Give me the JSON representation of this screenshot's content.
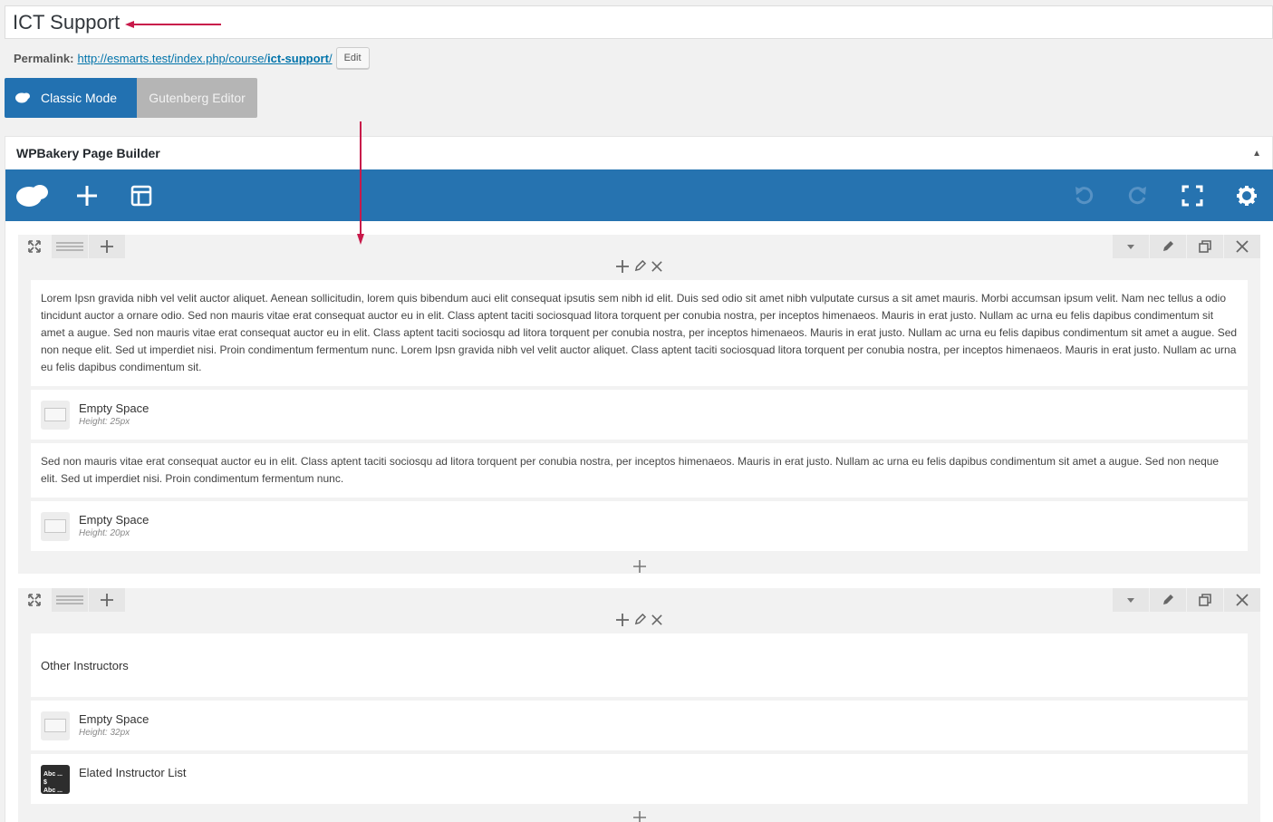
{
  "post_title": "ICT Support",
  "permalink": {
    "label": "Permalink:",
    "url_base": "http://esmarts.test/index.php/course/",
    "slug": "ict-support",
    "trail": "/",
    "edit_label": "Edit"
  },
  "editor_modes": {
    "classic_label": "Classic Mode",
    "gutenberg_label": "Gutenberg Editor"
  },
  "builder": {
    "title": "WPBakery Page Builder",
    "toolbar_left": [
      "wpbakery-logo-icon",
      "add-element-icon",
      "templates-icon"
    ],
    "toolbar_right": [
      "undo-icon",
      "redo-icon",
      "fullscreen-icon",
      "settings-icon"
    ]
  },
  "rows": [
    {
      "elements": [
        {
          "type": "text",
          "text": "Lorem Ipsn gravida nibh vel velit auctor aliquet. Aenean sollicitudin, lorem quis bibendum auci elit consequat ipsutis sem nibh id elit. Duis sed odio sit amet nibh vulputate cursus a sit amet mauris. Morbi accumsan ipsum velit. Nam nec tellus a odio tincidunt auctor a ornare odio. Sed non mauris vitae erat consequat auctor eu in elit. Class aptent taciti sociosquad litora torquent per conubia nostra, per inceptos himenaeos. Mauris in erat justo. Nullam ac urna eu felis dapibus condimentum sit amet a augue. Sed non mauris vitae erat consequat auctor eu in elit. Class aptent taciti sociosqu ad litora torquent per conubia nostra, per inceptos himenaeos. Mauris in erat justo. Nullam ac urna eu felis dapibus condimentum sit amet a augue. Sed non neque elit. Sed ut imperdiet nisi. Proin condimentum fermentum nunc. Lorem Ipsn gravida nibh vel velit auctor aliquet. Class aptent taciti sociosquad litora torquent per conubia nostra, per inceptos himenaeos. Mauris in erat justo. Nullam ac urna eu felis dapibus condimentum sit."
        },
        {
          "type": "empty_space",
          "title": "Empty Space",
          "meta": "Height: 25px"
        },
        {
          "type": "text",
          "text": "Sed non mauris vitae erat consequat auctor eu in elit. Class aptent taciti sociosqu ad litora torquent per conubia nostra, per inceptos himenaeos. Mauris in erat justo. Nullam ac urna eu felis dapibus condimentum sit amet a augue. Sed non neque elit. Sed ut imperdiet nisi. Proin condimentum fermentum nunc."
        },
        {
          "type": "empty_space",
          "title": "Empty Space",
          "meta": "Height: 20px"
        }
      ]
    },
    {
      "elements": [
        {
          "type": "heading",
          "text": "Other Instructors"
        },
        {
          "type": "empty_space",
          "title": "Empty Space",
          "meta": "Height: 32px"
        },
        {
          "type": "instructor_list",
          "title": "Elated Instructor List",
          "icon_text": [
            "Abc ... $",
            "Abc ... $"
          ]
        }
      ]
    }
  ],
  "colors": {
    "primary_blue": "#2271b1",
    "toolbar_blue": "#2673b0",
    "annotation_arrow": "#c8194a"
  }
}
